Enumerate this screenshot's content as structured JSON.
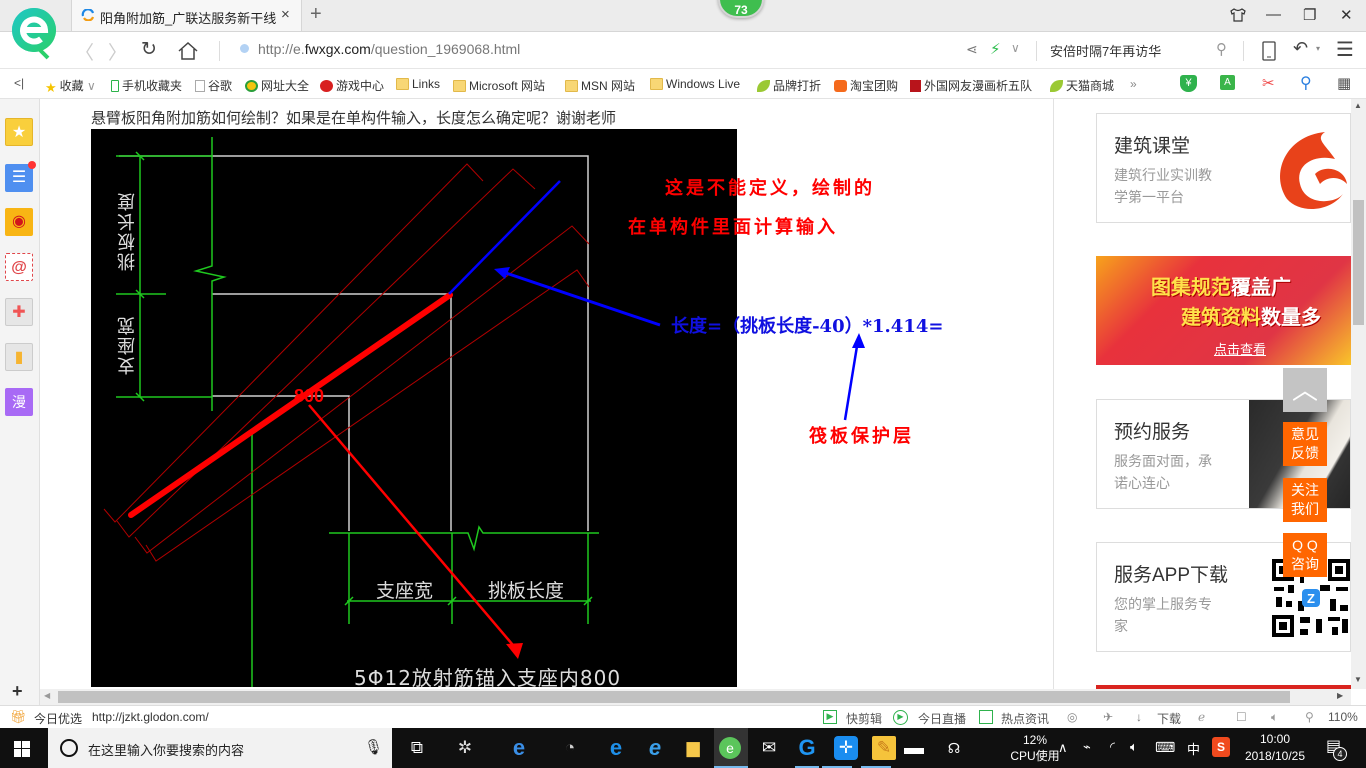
{
  "browser": {
    "tab": {
      "title": "阳角附加筋_广联达服务新干线",
      "close": "×"
    },
    "new_tab": "+",
    "badge_count": "73",
    "window_controls": {
      "skin": "skin-icon",
      "minimize": "—",
      "maximize": "❐",
      "close": "✕"
    },
    "address": {
      "url_prefix": "http://e.",
      "url_domain": "fwxgx.com",
      "url_path": "/question_1969068.html"
    },
    "search_box": {
      "value": "安倍时隔7年再访华"
    },
    "bookmarks": [
      {
        "label": "收藏",
        "icon": "star-icon"
      },
      {
        "label": "手机收藏夹",
        "icon": "phone-icon"
      },
      {
        "label": "谷歌",
        "icon": "page-icon"
      },
      {
        "label": "网址大全",
        "icon": "plus-circle-icon"
      },
      {
        "label": "游戏中心",
        "icon": "game-icon"
      },
      {
        "label": "Links",
        "icon": "folder-icon"
      },
      {
        "label": "Microsoft 网站",
        "icon": "folder-icon"
      },
      {
        "label": "MSN 网站",
        "icon": "folder-icon"
      },
      {
        "label": "Windows Live",
        "icon": "folder-icon"
      },
      {
        "label": "品牌打折",
        "icon": "leaf-icon"
      },
      {
        "label": "淘宝团购",
        "icon": "taobao-icon"
      },
      {
        "label": "外国网友漫画析五队",
        "icon": "bookmark-red-icon"
      },
      {
        "label": "天猫商城",
        "icon": "leaf-icon"
      }
    ],
    "more_bookmarks": "»"
  },
  "sidebar": {
    "items": [
      {
        "name": "favorites",
        "glyph": "★",
        "color": "#f7c531"
      },
      {
        "name": "news",
        "glyph": "☰",
        "color": "#4a8ee8"
      },
      {
        "name": "weibo",
        "glyph": "◉",
        "color": "#f6b21c"
      },
      {
        "name": "mail",
        "glyph": "@",
        "color": "#ffffff"
      },
      {
        "name": "games",
        "glyph": "✚",
        "color": "#e8e8e8"
      },
      {
        "name": "reading",
        "glyph": "▮",
        "color": "#e8e8e8"
      },
      {
        "name": "comics",
        "glyph": "漫",
        "color": "#a066f0"
      }
    ]
  },
  "content": {
    "question": "悬臂板阳角附加筋如何绘制？如果是在单构件输入，长度怎么确定呢？谢谢老师",
    "drawing": {
      "label_cantilever_length_vertical": "挑板长度",
      "label_support_width_vertical": "支座宽",
      "label_support_width_horizontal": "支座宽",
      "label_cantilever_length_horizontal": "挑板长度",
      "dimension_800": "800",
      "bottom_note": "5Φ12放射筋锚入支座内800"
    },
    "annotations": {
      "line1": "这是不能定义，绘制的",
      "line2": "在单构件里面计算输入",
      "formula": "长度=（挑板长度-40）*1.414=",
      "cover_note": "筏板保护层"
    }
  },
  "right_column": {
    "cards": [
      {
        "title": "建筑课堂",
        "subtitle_1": "建筑行业实训教",
        "subtitle_2": "学第一平台"
      },
      {
        "title": "预约服务",
        "subtitle_1": "服务面对面，承",
        "subtitle_2": "诺心连心"
      },
      {
        "title": "服务APP下载",
        "subtitle_1": "您的掌上服务专",
        "subtitle_2": "家"
      }
    ],
    "banner": {
      "line1_a": "图集规范",
      "line1_b": "覆盖广",
      "line2_a": "建筑资料",
      "line2_b": "数量多",
      "cta": "点击查看"
    },
    "float_buttons": {
      "to_top": "︿",
      "feedback_1": "意见",
      "feedback_2": "反馈",
      "follow_1": "关注",
      "follow_2": "我们",
      "qq_1": "Q Q",
      "qq_2": "咨询"
    }
  },
  "statusbar": {
    "left_label": "今日优选",
    "left_url": "http://jzkt.glodon.com/",
    "items": [
      "快剪辑",
      "今日直播",
      "热点资讯"
    ],
    "download": "下载",
    "zoom": "110%"
  },
  "taskbar": {
    "search_placeholder": "在这里输入你要搜索的内容",
    "cpu_percent": "12%",
    "cpu_label": "CPU使用",
    "ime": "中",
    "time": "10:00",
    "date": "2018/10/25",
    "notifications": "4"
  }
}
